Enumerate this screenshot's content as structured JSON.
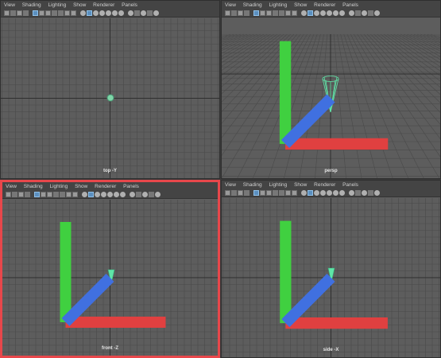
{
  "menu": [
    "View",
    "Shading",
    "Lighting",
    "Show",
    "Renderer",
    "Panels"
  ],
  "panels": [
    {
      "id": "top",
      "camera": "top -Y"
    },
    {
      "id": "persp",
      "camera": "persp"
    },
    {
      "id": "front",
      "camera": "front -Z"
    },
    {
      "id": "side",
      "camera": "side -X"
    }
  ],
  "colors": {
    "viewport_bg": "#5d5d5d",
    "grid": "#4a4a4a",
    "grid_axis": "#2e2e2e",
    "object": "#5fe6a8",
    "active_border": "#e8474b"
  },
  "toolbar_icons": [
    "camera-icon",
    "camera-attr-icon",
    "bookmark-icon",
    "image-plane-icon",
    "grid-icon",
    "film-gate-icon",
    "resolution-gate-icon",
    "gate-mask-icon",
    "field-chart-icon",
    "safe-action-icon",
    "safe-title-icon",
    "wireframe-icon",
    "smooth-shade-icon",
    "default-material-icon",
    "textured-icon",
    "lights-icon",
    "shadows-icon",
    "xray-icon",
    "isolate-icon",
    "screen-space-ao-icon",
    "motion-blur-icon",
    "anti-alias-icon",
    "depth-of-field-icon"
  ]
}
